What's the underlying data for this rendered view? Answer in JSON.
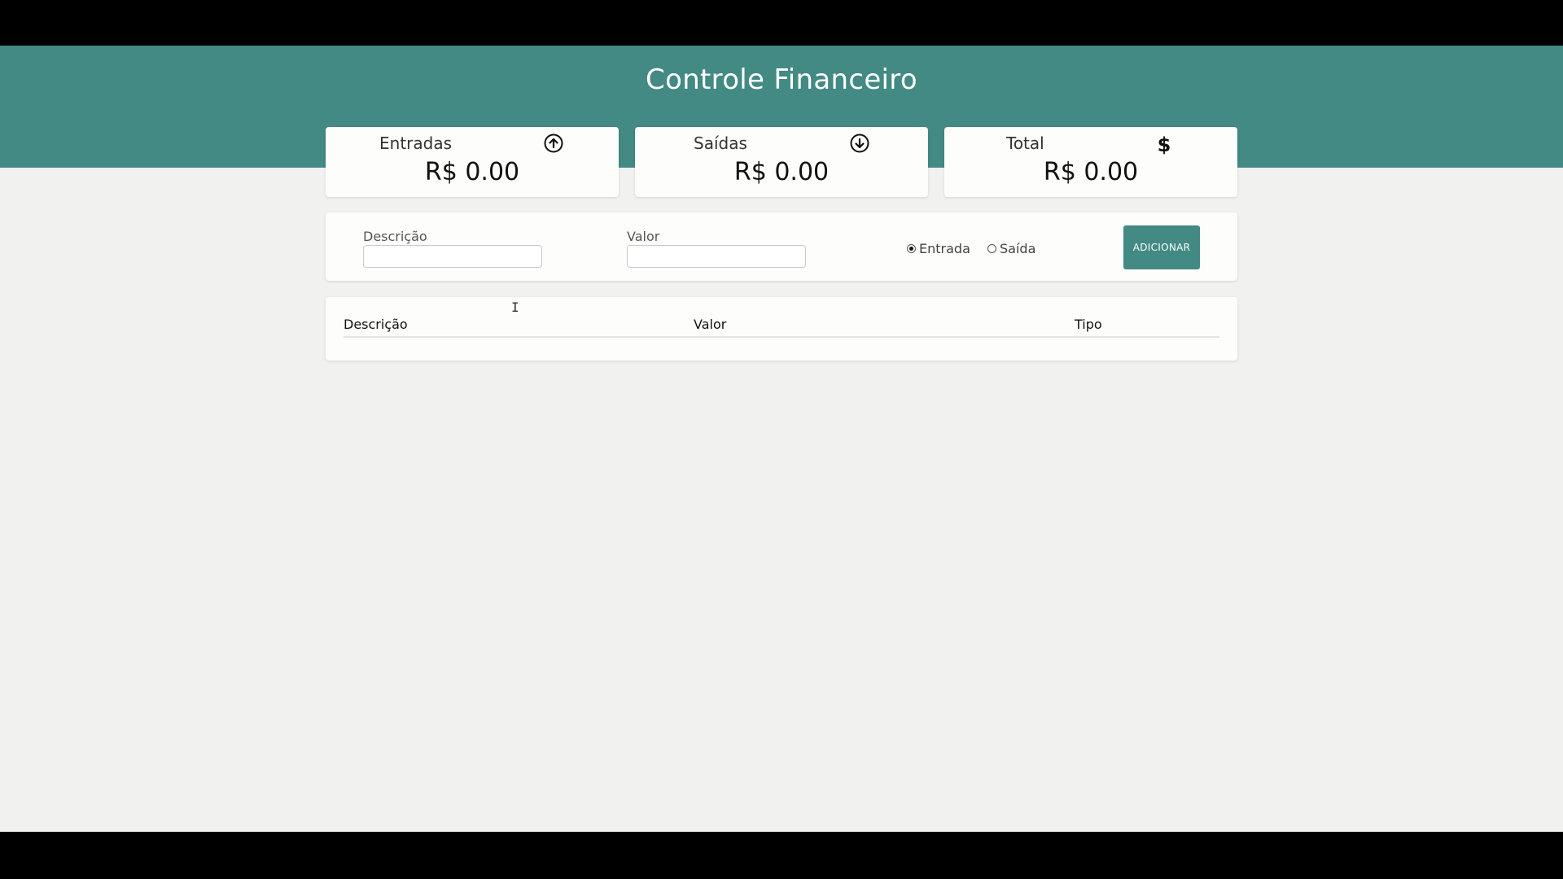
{
  "app": {
    "title": "Controle Financeiro",
    "accent_color": "#428a83"
  },
  "summary": {
    "cards": [
      {
        "label": "Entradas",
        "value": "R$ 0.00",
        "icon": "arrow-circle-up-icon"
      },
      {
        "label": "Saídas",
        "value": "R$ 0.00",
        "icon": "arrow-circle-down-icon"
      },
      {
        "label": "Total",
        "value": "R$ 0.00",
        "icon": "dollar-icon"
      }
    ]
  },
  "form": {
    "description_label": "Descrição",
    "description_value": "",
    "amount_label": "Valor",
    "amount_value": "",
    "radio_entry_label": "Entrada",
    "radio_exit_label": "Saída",
    "selected_type": "Entrada",
    "add_button_label": "ADICIONAR"
  },
  "table": {
    "columns": [
      "Descrição",
      "Valor",
      "Tipo"
    ],
    "rows": []
  }
}
